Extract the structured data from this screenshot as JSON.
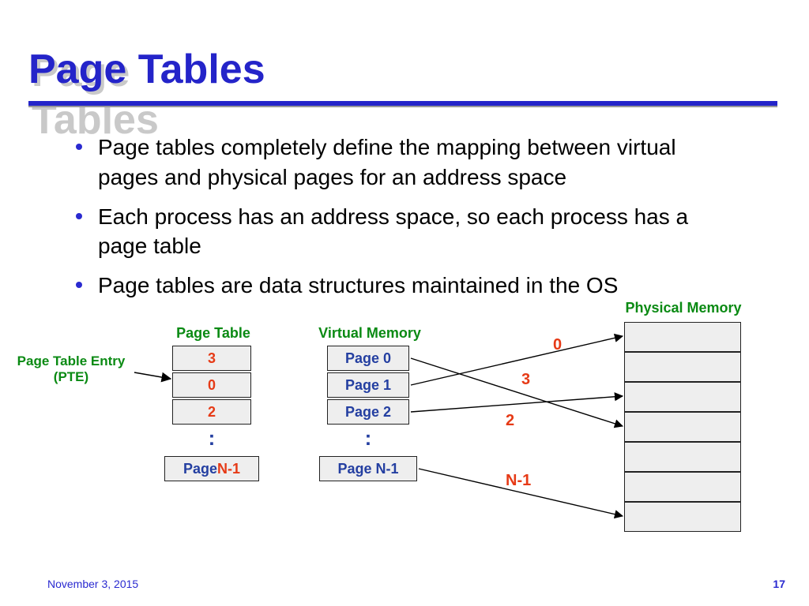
{
  "title": "Page Tables",
  "bullets": [
    "Page tables completely define the mapping between virtual pages and physical pages for an address space",
    "Each process has an address space, so each process has a page table",
    "Page tables are data structures maintained in the OS"
  ],
  "diagram": {
    "labels": {
      "page_table": "Page Table",
      "virtual_memory": "Virtual Memory",
      "physical_memory": "Physical Memory",
      "pte_l1": "Page Table Entry",
      "pte_l2": "(PTE)"
    },
    "page_table": {
      "entries": [
        "3",
        "0",
        "2"
      ],
      "dots": ":",
      "last_prefix": "Page ",
      "last_suffix": "N-1"
    },
    "virtual_memory": {
      "entries": [
        "Page 0",
        "Page 1",
        "Page 2"
      ],
      "dots": ":",
      "last": "Page N-1"
    },
    "physical_memory": {
      "rows": 7
    },
    "mappings": {
      "m0": "0",
      "m3": "3",
      "m2": "2",
      "mn1": "N-1"
    }
  },
  "footer": {
    "date": "November 3, 2015",
    "page": "17"
  }
}
